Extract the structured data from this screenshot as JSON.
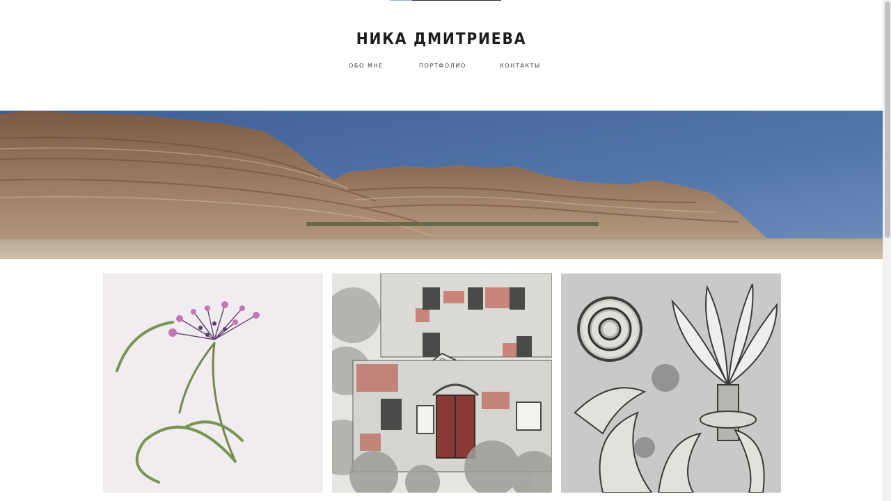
{
  "site": {
    "title": "НИКА ДМИТРИЕВА"
  },
  "nav": {
    "items": [
      {
        "label": "ОБО МНЕ"
      },
      {
        "label": "ПОРТФОЛИО"
      },
      {
        "label": "КОНТАКТЫ"
      }
    ]
  },
  "hero": {
    "image": "desert-mountains-landscape"
  },
  "gallery": {
    "items": [
      {
        "image": "botanical-flower-drawing"
      },
      {
        "image": "old-house-pencil-drawing"
      },
      {
        "image": "acanthus-capital-pencil-drawing"
      }
    ]
  },
  "colors": {
    "text": "#1c1c1c",
    "nav_text": "#3a3a3a",
    "background": "#ffffff",
    "sky": "#4d6a9f"
  }
}
